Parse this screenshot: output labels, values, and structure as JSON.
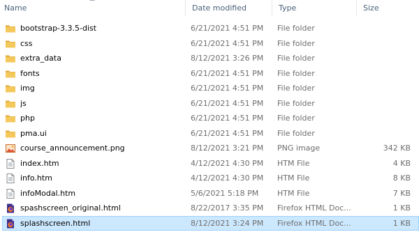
{
  "columns": {
    "name": "Name",
    "date": "Date modified",
    "type": "Type",
    "size": "Size"
  },
  "files": [
    {
      "name": "bootstrap-3.3.5-dist",
      "date": "6/21/2021 4:51 PM",
      "type": "File folder",
      "size": "",
      "icon": "folder-icon"
    },
    {
      "name": "css",
      "date": "6/21/2021 4:51 PM",
      "type": "File folder",
      "size": "",
      "icon": "folder-icon"
    },
    {
      "name": "extra_data",
      "date": "8/12/2021 3:26 PM",
      "type": "File folder",
      "size": "",
      "icon": "folder-icon"
    },
    {
      "name": "fonts",
      "date": "6/21/2021 4:51 PM",
      "type": "File folder",
      "size": "",
      "icon": "folder-icon"
    },
    {
      "name": "img",
      "date": "6/21/2021 4:51 PM",
      "type": "File folder",
      "size": "",
      "icon": "folder-icon"
    },
    {
      "name": "js",
      "date": "6/21/2021 4:51 PM",
      "type": "File folder",
      "size": "",
      "icon": "folder-icon"
    },
    {
      "name": "php",
      "date": "6/21/2021 4:51 PM",
      "type": "File folder",
      "size": "",
      "icon": "folder-icon"
    },
    {
      "name": "pma.ui",
      "date": "6/21/2021 4:51 PM",
      "type": "File folder",
      "size": "",
      "icon": "folder-icon"
    },
    {
      "name": "course_announcement.png",
      "date": "8/12/2021 3:21 PM",
      "type": "PNG image",
      "size": "342 KB",
      "icon": "image-file-icon"
    },
    {
      "name": "index.htm",
      "date": "4/12/2021 4:30 PM",
      "type": "HTM File",
      "size": "4 KB",
      "icon": "document-icon"
    },
    {
      "name": "info.htm",
      "date": "4/12/2021 4:30 PM",
      "type": "HTM File",
      "size": "8 KB",
      "icon": "document-icon"
    },
    {
      "name": "infoModal.htm",
      "date": "5/6/2021 5:18 PM",
      "type": "HTM File",
      "size": "7 KB",
      "icon": "document-icon"
    },
    {
      "name": "spashscreen_original.html",
      "date": "8/22/2017 3:35 PM",
      "type": "Firefox HTML Doc...",
      "size": "1 KB",
      "icon": "firefox-html-icon"
    },
    {
      "name": "splashscreen.html",
      "date": "8/12/2021 3:24 PM",
      "type": "Firefox HTML Doc...",
      "size": "1 KB",
      "icon": "firefox-html-icon",
      "selected": true
    }
  ],
  "colors": {
    "selection_fill": "#cce8ff",
    "selection_border": "#99d1ff",
    "folder": "#e8b84a",
    "header_text": "#4c607a"
  }
}
